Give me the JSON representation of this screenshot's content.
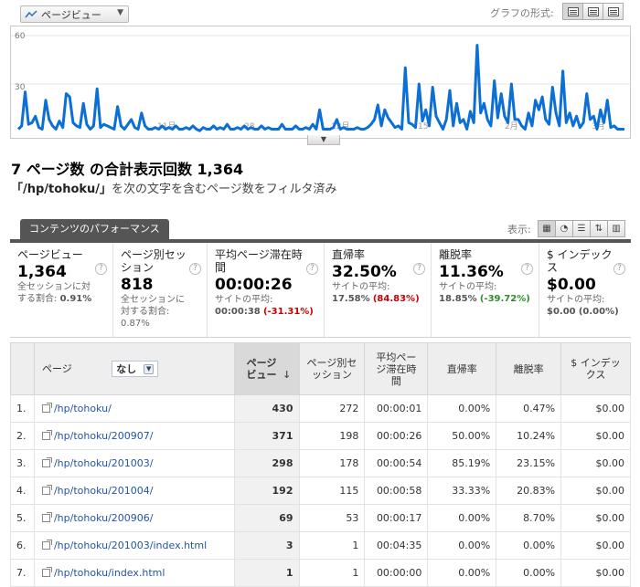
{
  "toolbar": {
    "metric_label": "ページビュー",
    "graph_mode_label": "グラフの形式:"
  },
  "chart": {
    "y_ticks": [
      "60",
      "30"
    ],
    "line_color": "#0b6fd6",
    "x_labels": [
      "11月",
      "28",
      "12月",
      "15",
      "2月",
      "3月"
    ]
  },
  "chart_data": {
    "type": "line",
    "ylim": [
      0,
      60
    ],
    "series": [
      {
        "values": [
          2,
          4,
          25,
          5,
          6,
          10,
          3,
          2,
          20,
          8,
          4,
          2,
          7,
          3,
          24,
          22,
          6,
          4,
          3,
          18,
          5,
          2,
          4,
          27,
          3,
          5,
          4,
          3,
          2,
          16,
          4,
          2,
          5,
          8,
          3,
          2,
          12,
          4,
          2,
          2,
          3,
          2,
          4,
          2,
          3,
          2,
          4,
          2,
          2,
          3,
          2,
          4,
          2,
          1,
          3,
          2,
          2,
          4,
          2,
          3,
          2,
          5,
          2,
          2,
          3,
          2,
          4,
          2,
          3,
          2,
          2,
          4,
          2,
          3,
          2,
          2,
          2,
          5,
          2,
          2,
          2,
          4,
          2,
          2,
          3,
          2,
          5,
          2,
          14,
          2,
          2,
          2,
          3,
          8,
          2,
          3,
          2,
          2,
          2,
          3,
          2,
          2,
          3,
          5,
          8,
          17,
          4,
          14,
          9,
          6,
          3,
          4,
          2,
          40,
          6,
          5,
          3,
          30,
          7,
          14,
          4,
          28,
          10,
          6,
          2,
          8,
          26,
          4,
          18,
          6,
          8,
          2,
          13,
          6,
          54,
          12,
          18,
          8,
          4,
          32,
          9,
          24,
          10,
          6,
          30,
          8,
          8,
          4,
          2,
          12,
          4,
          20,
          14,
          22,
          8,
          5,
          28,
          12,
          4,
          38,
          6,
          12,
          4,
          10,
          3,
          6,
          24,
          8,
          10,
          2,
          14,
          6,
          20,
          3,
          4,
          2,
          2,
          2
        ]
      }
    ]
  },
  "summary": {
    "title": "7 ページ数 の合計表示回数 1,364",
    "filter_path": "「/hp/tohoku/」",
    "filter_text": "を次の文字を含むページ数をフィルタ済み"
  },
  "tabs": {
    "active": "コンテンツのパフォーマンス",
    "view_label": "表示:"
  },
  "cards": [
    {
      "name": "ページビュー",
      "value": "1,364",
      "sub1": "全セッションに対",
      "sub2": "する割合: ",
      "sub2b": "0.91%"
    },
    {
      "name": "ページ別セッション",
      "value": "818",
      "sub1": "全セッションに",
      "sub2": "対する割合:",
      "sub3": "0.87%"
    },
    {
      "name": "平均ページ滞在時間",
      "value": "00:00:26",
      "sub1": "サイトの平均:",
      "avg": "00:00:38",
      "delta": "(-31.31%)"
    },
    {
      "name": "直帰率",
      "value": "32.50%",
      "sub1": "サイトの平均:",
      "avg": "17.58%",
      "delta": "(84.83%)"
    },
    {
      "name": "離脱率",
      "value": "11.36%",
      "sub1": "サイトの平均:",
      "avg": "18.85%",
      "delta": "(-39.72%)"
    },
    {
      "name": "$ インデックス",
      "value": "$0.00",
      "sub1": "サイトの平均:",
      "avg": "$0.00",
      "delta": "(0.00%)"
    }
  ],
  "table": {
    "col_page": "ページ",
    "dimension_select": "なし",
    "col_pageviews": "ページビュー",
    "col_sessions": "ページ別セッション",
    "col_avgtime": "平均ページ滞在時間",
    "col_bounce": "直帰率",
    "col_exit": "離脱率",
    "col_index": "$ インデックス",
    "rows": [
      {
        "num": "1.",
        "page": "/hp/tohoku/",
        "pv": "430",
        "sessions": "272",
        "time": "00:00:01",
        "bounce": "0.00%",
        "exit": "0.47%",
        "index": "$0.00"
      },
      {
        "num": "2.",
        "page": "/hp/tohoku/200907/",
        "pv": "371",
        "sessions": "198",
        "time": "00:00:26",
        "bounce": "50.00%",
        "exit": "10.24%",
        "index": "$0.00"
      },
      {
        "num": "3.",
        "page": "/hp/tohoku/201003/",
        "pv": "298",
        "sessions": "178",
        "time": "00:00:54",
        "bounce": "85.19%",
        "exit": "23.15%",
        "index": "$0.00"
      },
      {
        "num": "4.",
        "page": "/hp/tohoku/201004/",
        "pv": "192",
        "sessions": "115",
        "time": "00:00:58",
        "bounce": "33.33%",
        "exit": "20.83%",
        "index": "$0.00"
      },
      {
        "num": "5.",
        "page": "/hp/tohoku/200906/",
        "pv": "69",
        "sessions": "53",
        "time": "00:00:17",
        "bounce": "0.00%",
        "exit": "8.70%",
        "index": "$0.00"
      },
      {
        "num": "6.",
        "page": "/hp/tohoku/201003/index.html",
        "pv": "3",
        "sessions": "1",
        "time": "00:04:35",
        "bounce": "0.00%",
        "exit": "0.00%",
        "index": "$0.00"
      },
      {
        "num": "7.",
        "page": "/hp/tohoku/index.html",
        "pv": "1",
        "sessions": "1",
        "time": "00:00:00",
        "bounce": "0.00%",
        "exit": "0.00%",
        "index": "$0.00"
      }
    ]
  }
}
